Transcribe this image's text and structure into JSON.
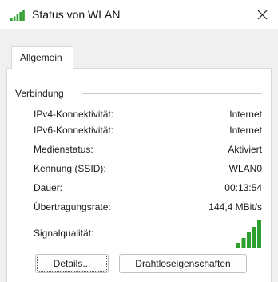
{
  "window": {
    "title": "Status von WLAN",
    "title_icon": "wifi-signal-icon",
    "close_icon": "close-icon"
  },
  "tabs": [
    {
      "label": "Allgemein",
      "active": true
    }
  ],
  "connection": {
    "group_label": "Verbindung",
    "rows": [
      {
        "label": "IPv4-Konnektivität:",
        "value": "Internet"
      },
      {
        "label": "IPv6-Konnektivität:",
        "value": "Internet"
      },
      {
        "label": "Medienstatus:",
        "value": "Aktiviert"
      },
      {
        "label": "Kennung (SSID):",
        "value": "WLAN0"
      },
      {
        "label": "Dauer:",
        "value": "00:13:54"
      },
      {
        "label": "Übertragungsrate:",
        "value": "144,4 MBit/s"
      }
    ],
    "signal": {
      "label": "Signalqualität:",
      "bars_total": 5,
      "bars_filled": 5,
      "color": "#2e9e2e"
    }
  },
  "buttons": {
    "details": {
      "label_mnemonic": "D",
      "label_rest": "etails..."
    },
    "wireless": {
      "label_pre": "D",
      "label_mnemonic": "r",
      "label_rest": "ahtloseigenschaften"
    }
  },
  "colors": {
    "background": "#f0f0f0",
    "panel": "#ffffff",
    "signal": "#2e9e2e"
  }
}
